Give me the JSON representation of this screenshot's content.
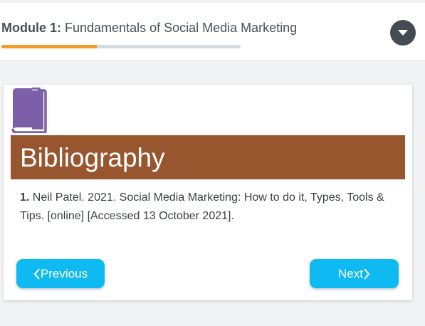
{
  "header": {
    "module_number": "Module 1:",
    "module_title": "Fundamentals of Social Media Marketing",
    "progress_percent": 40,
    "progress_color": "#f39c27",
    "toggle_icon": "chevron-down-icon"
  },
  "card": {
    "icon": "book-icon",
    "title": "Bibliography",
    "banner_color": "#98562e",
    "entries": [
      {
        "number": "1.",
        "text": "Neil Patel. 2021. Social Media Marketing: How to do it, Types, Tools & Tips. [online] [Accessed 13 October 2021]."
      }
    ]
  },
  "navigation": {
    "previous_label": "Previous",
    "next_label": "Next",
    "button_color": "#0fb9f2"
  }
}
